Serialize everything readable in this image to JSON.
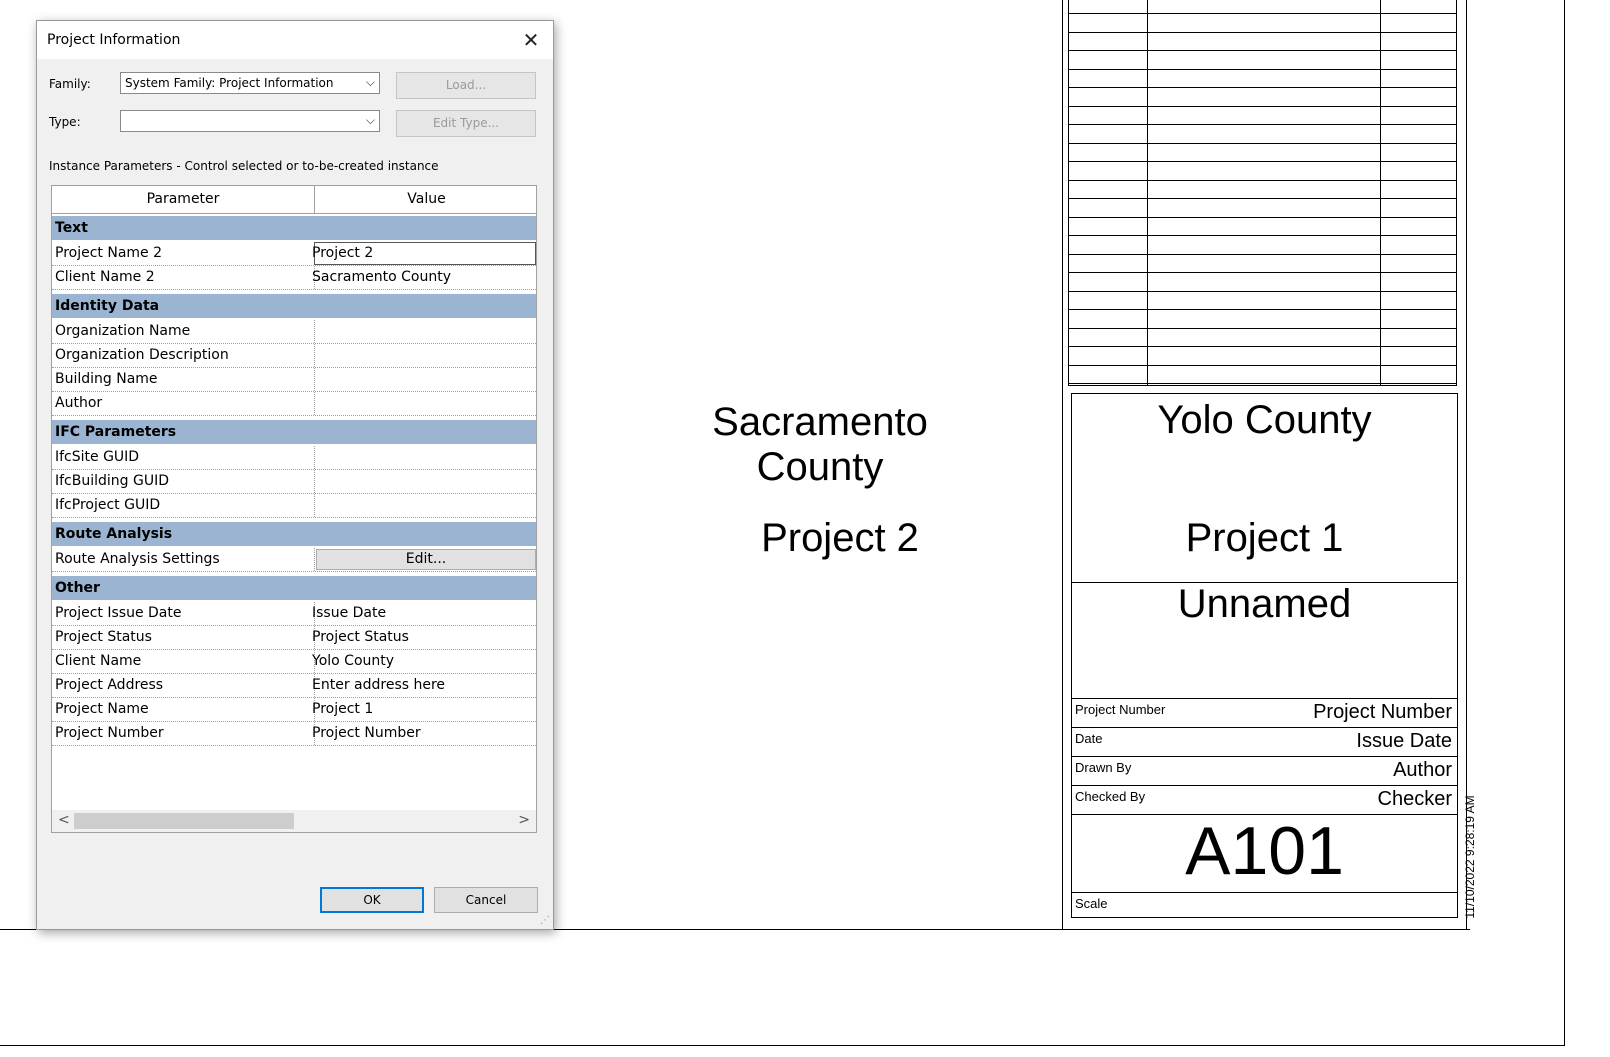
{
  "dialog": {
    "title": "Project Information",
    "family_label": "Family:",
    "family_value": "System Family: Project Information",
    "type_label": "Type:",
    "type_value": "",
    "load_button": "Load...",
    "edit_type_button": "Edit Type...",
    "instance_params_label": "Instance Parameters - Control selected or to-be-created instance",
    "grid": {
      "col_parameter": "Parameter",
      "col_value": "Value",
      "groups": [
        {
          "name": "Text",
          "rows": [
            {
              "param": "Project Name 2",
              "value": "Project 2"
            },
            {
              "param": "Client Name 2",
              "value": "Sacramento County"
            }
          ]
        },
        {
          "name": "Identity Data",
          "rows": [
            {
              "param": "Organization Name",
              "value": ""
            },
            {
              "param": "Organization Description",
              "value": ""
            },
            {
              "param": "Building Name",
              "value": ""
            },
            {
              "param": "Author",
              "value": ""
            }
          ]
        },
        {
          "name": "IFC Parameters",
          "rows": [
            {
              "param": "IfcSite GUID",
              "value": ""
            },
            {
              "param": "IfcBuilding GUID",
              "value": ""
            },
            {
              "param": "IfcProject GUID",
              "value": ""
            }
          ]
        },
        {
          "name": "Route Analysis",
          "rows": [
            {
              "param": "Route Analysis Settings",
              "value": "Edit..."
            }
          ]
        },
        {
          "name": "Other",
          "rows": [
            {
              "param": "Project Issue Date",
              "value": "Issue Date"
            },
            {
              "param": "Project Status",
              "value": "Project Status"
            },
            {
              "param": "Client Name",
              "value": "Yolo County"
            },
            {
              "param": "Project Address",
              "value": "Enter address here"
            },
            {
              "param": "Project Name",
              "value": "Project 1"
            },
            {
              "param": "Project Number",
              "value": "Project Number"
            }
          ]
        }
      ]
    },
    "ok_button": "OK",
    "cancel_button": "Cancel"
  },
  "sheet": {
    "client_name_2_line1": "Sacramento",
    "client_name_2_line2": "County",
    "project_name_2": "Project 2",
    "titleblock": {
      "client_name": "Yolo County",
      "project_name": "Project 1",
      "sheet_name": "Unnamed",
      "project_number_label": "Project Number",
      "project_number_value": "Project Number",
      "date_label": "Date",
      "date_value": "Issue Date",
      "drawn_by_label": "Drawn By",
      "drawn_by_value": "Author",
      "checked_by_label": "Checked By",
      "checked_by_value": "Checker",
      "sheet_number": "A101",
      "scale_label": "Scale"
    },
    "timestamp": "11/10/2022 9:28:19 AM"
  }
}
